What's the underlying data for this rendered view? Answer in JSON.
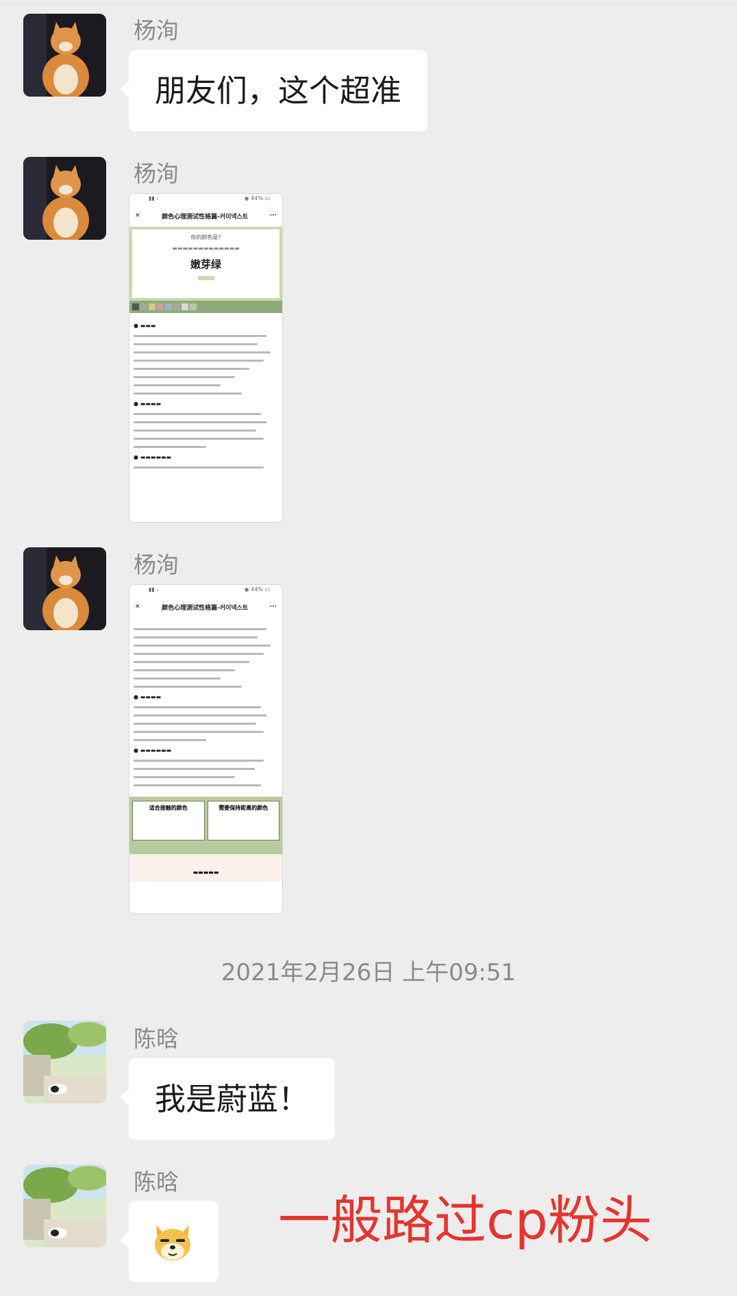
{
  "messages": [
    {
      "sender": "杨洵",
      "type": "text",
      "text": "朋友们，这个超准"
    },
    {
      "sender": "杨洵",
      "type": "image"
    },
    {
      "sender": "杨洵",
      "type": "image"
    },
    {
      "sender": "陈晗",
      "type": "text",
      "text": "我是蔚蓝！"
    },
    {
      "sender": "陈晗",
      "type": "sticker"
    }
  ],
  "timestamp": "2021年2月26日 上午09:51",
  "overlay_caption": "一般路过cp粉头",
  "screenshot1": {
    "title": "颜色心理测试性格篇-커이넥스트",
    "card_big": "嫩芽绿"
  },
  "screenshot2": {
    "title": "颜色心理测试性格篇-커이넥스트",
    "box_left": "适合接触的颜色",
    "box_right": "需要保持距离的颜色"
  },
  "colors": {
    "background": "#ededed",
    "bubble": "#ffffff",
    "caption": "#e4352e"
  }
}
